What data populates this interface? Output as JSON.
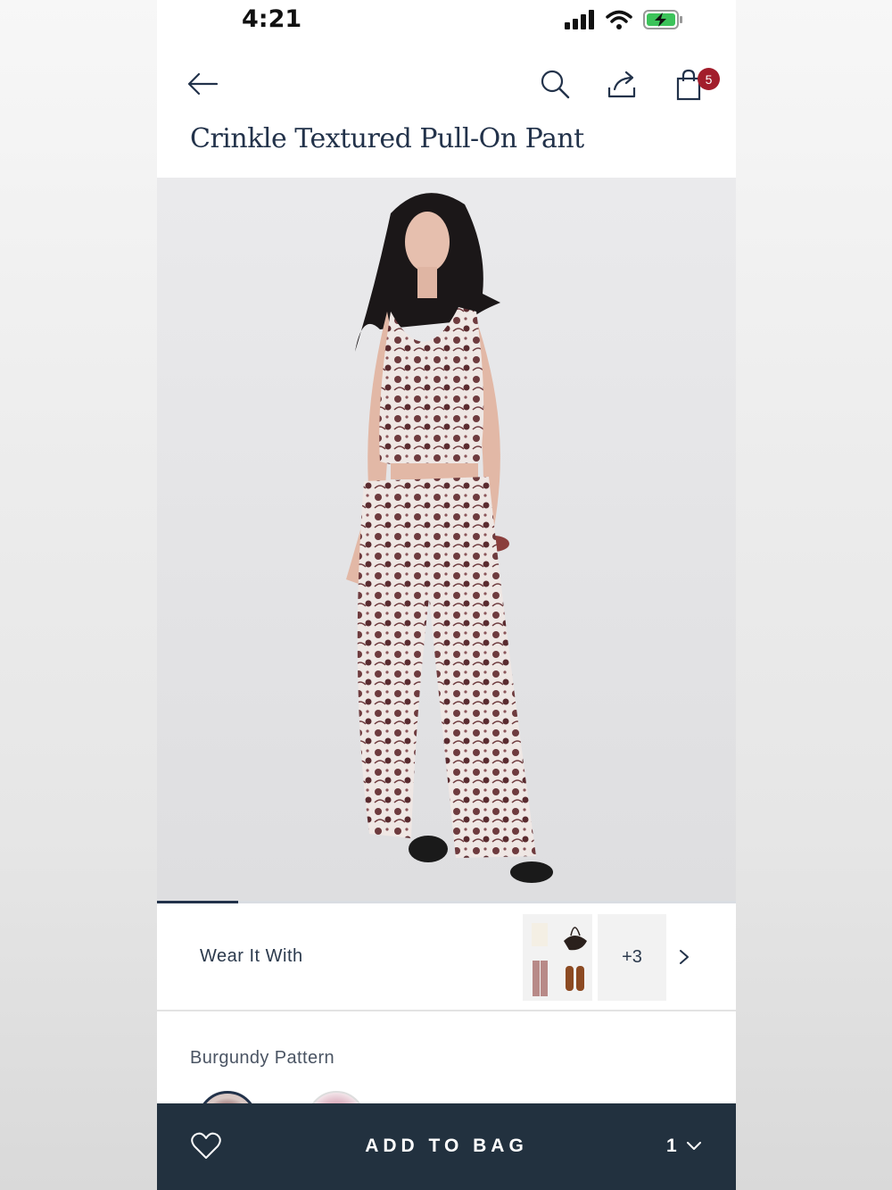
{
  "status": {
    "time": "4:21"
  },
  "header": {
    "cart_count": "5"
  },
  "product": {
    "title": "Crinkle Textured Pull-On Pant"
  },
  "gallery": {
    "progress": 0.14
  },
  "wear_it_with": {
    "label": "Wear It With",
    "more_label": "+3"
  },
  "color": {
    "label": "Burgundy Pattern"
  },
  "bottom_bar": {
    "add_label": "ADD TO BAG",
    "quantity": "1"
  },
  "colors": {
    "navy": "#22313f",
    "badge": "#a21d2b"
  }
}
